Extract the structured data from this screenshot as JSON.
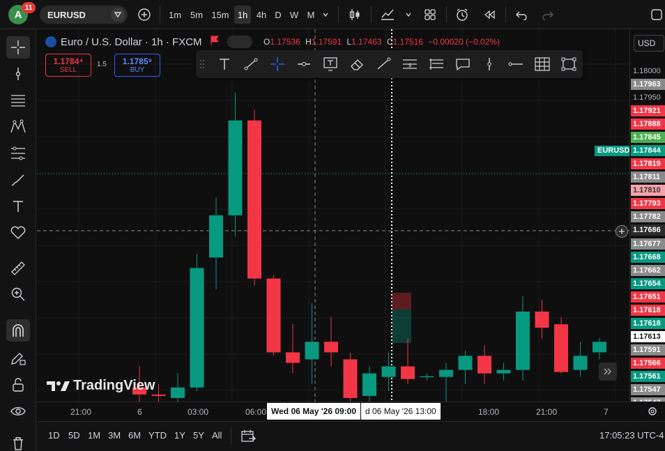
{
  "topbar": {
    "avatar_letter": "A",
    "notifications": "11",
    "symbol": "EURUSD",
    "timeframes": [
      "1m",
      "5m",
      "15m",
      "1h",
      "4h",
      "D",
      "W",
      "M"
    ],
    "active_timeframe": "1h"
  },
  "legend": {
    "title": "Euro / U.S. Dollar · 1h · FXCM",
    "open_label": "O",
    "open": "1.17536",
    "high_label": "H",
    "high": "1.17591",
    "low_label": "L",
    "low": "1.17463",
    "close_label": "C",
    "close": "1.17516",
    "change": "−0.00020 (−0.02%)"
  },
  "trade": {
    "sell_price": "1.1784⁴",
    "sell_label": "SELL",
    "spread": "1.5",
    "buy_price": "1.1785⁹",
    "buy_label": "BUY"
  },
  "price_scale": {
    "currency": "USD",
    "symbol_tag": "EURUSD",
    "labels": [
      {
        "text": "1.18000",
        "style": "plain"
      },
      {
        "text": "1.17963",
        "style": "gray"
      },
      {
        "text": "1.17950",
        "style": "plain"
      },
      {
        "text": "1.17921",
        "style": "red"
      },
      {
        "text": "1.17888",
        "style": "red"
      },
      {
        "text": "1.17845",
        "style": "greenb"
      },
      {
        "text": "1.17844",
        "style": "green"
      },
      {
        "text": "1.17819",
        "style": "red"
      },
      {
        "text": "1.17811",
        "style": "gray"
      },
      {
        "text": "1.17810",
        "style": "pink"
      },
      {
        "text": "1.17793",
        "style": "red"
      },
      {
        "text": "1.17782",
        "style": "gray"
      },
      {
        "text": "1.17686",
        "style": "dark"
      },
      {
        "text": "1.17677",
        "style": "gray"
      },
      {
        "text": "1.17668",
        "style": "green"
      },
      {
        "text": "1.17662",
        "style": "gray"
      },
      {
        "text": "1.17654",
        "style": "green"
      },
      {
        "text": "1.17651",
        "style": "red"
      },
      {
        "text": "1.17618",
        "style": "red"
      },
      {
        "text": "1.17618",
        "style": "green"
      },
      {
        "text": "1.17613",
        "style": "white"
      },
      {
        "text": "1.17591",
        "style": "gray"
      },
      {
        "text": "1.17566",
        "style": "red"
      },
      {
        "text": "1.17561",
        "style": "green"
      },
      {
        "text": "1.17547",
        "style": "gray"
      },
      {
        "text": "1.17547",
        "style": "gray"
      }
    ]
  },
  "time_axis": {
    "labels": [
      "21:00",
      "6",
      "03:00",
      "06:00",
      "18:00",
      "21:00",
      "7"
    ],
    "crosshair_time": "Wed 06 May '26   09:00",
    "crosshair_time_2": "d 06 May '26   13:00"
  },
  "bottombar": {
    "ranges": [
      "1D",
      "5D",
      "1M",
      "3M",
      "6M",
      "YTD",
      "1Y",
      "5Y",
      "All"
    ],
    "clock": "17:05:23 UTC-4"
  },
  "brand": {
    "logo_text": "TradingView"
  },
  "colors": {
    "up": "#089981",
    "down": "#f23645",
    "background": "#0f0f0f"
  },
  "chart_data": {
    "type": "candlestick",
    "symbol": "EURUSD",
    "interval": "1h",
    "ylim": [
      1.1752,
      1.1802
    ],
    "candles": [
      {
        "o": 1.1754,
        "h": 1.1757,
        "l": 1.1752,
        "c": 1.1753
      },
      {
        "o": 1.1753,
        "h": 1.17545,
        "l": 1.1752,
        "c": 1.17528
      },
      {
        "o": 1.17525,
        "h": 1.1756,
        "l": 1.1752,
        "c": 1.1754
      },
      {
        "o": 1.1754,
        "h": 1.1773,
        "l": 1.17535,
        "c": 1.1771
      },
      {
        "o": 1.17725,
        "h": 1.1781,
        "l": 1.1768,
        "c": 1.17785
      },
      {
        "o": 1.17785,
        "h": 1.1796,
        "l": 1.17755,
        "c": 1.1792
      },
      {
        "o": 1.1792,
        "h": 1.17935,
        "l": 1.17685,
        "c": 1.17695
      },
      {
        "o": 1.17695,
        "h": 1.177,
        "l": 1.17585,
        "c": 1.1759
      },
      {
        "o": 1.1759,
        "h": 1.1763,
        "l": 1.1756,
        "c": 1.17575
      },
      {
        "o": 1.1758,
        "h": 1.1766,
        "l": 1.17545,
        "c": 1.17605
      },
      {
        "o": 1.17605,
        "h": 1.1764,
        "l": 1.1757,
        "c": 1.1759
      },
      {
        "o": 1.1758,
        "h": 1.1759,
        "l": 1.175,
        "c": 1.17525
      },
      {
        "o": 1.17528,
        "h": 1.1757,
        "l": 1.1751,
        "c": 1.1756
      },
      {
        "o": 1.17555,
        "h": 1.1759,
        "l": 1.17535,
        "c": 1.1757
      },
      {
        "o": 1.1757,
        "h": 1.1761,
        "l": 1.17545,
        "c": 1.17552
      },
      {
        "o": 1.17555,
        "h": 1.1756,
        "l": 1.1755,
        "c": 1.17556
      },
      {
        "o": 1.17555,
        "h": 1.17575,
        "l": 1.1751,
        "c": 1.17565
      },
      {
        "o": 1.17565,
        "h": 1.17592,
        "l": 1.17545,
        "c": 1.17585
      },
      {
        "o": 1.17585,
        "h": 1.176,
        "l": 1.17545,
        "c": 1.1756
      },
      {
        "o": 1.1756,
        "h": 1.17575,
        "l": 1.1755,
        "c": 1.17565
      },
      {
        "o": 1.17565,
        "h": 1.1767,
        "l": 1.1755,
        "c": 1.17648
      },
      {
        "o": 1.17648,
        "h": 1.17665,
        "l": 1.1761,
        "c": 1.17625
      },
      {
        "o": 1.1763,
        "h": 1.1764,
        "l": 1.1756,
        "c": 1.17562
      },
      {
        "o": 1.17565,
        "h": 1.17605,
        "l": 1.17555,
        "c": 1.17585
      },
      {
        "o": 1.1759,
        "h": 1.1761,
        "l": 1.1758,
        "c": 1.17605
      }
    ],
    "last_price": 1.17844,
    "crosshair_price": "1.17686"
  }
}
